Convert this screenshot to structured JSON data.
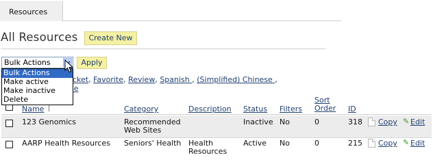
{
  "tabs": {
    "active_label": "Resources"
  },
  "page": {
    "title": "All Resources",
    "create_label": "Create New"
  },
  "bulk": {
    "selected": "Bulk Actions",
    "apply_label": "Apply",
    "options": [
      "Bulk Actions",
      "Make active",
      "Make inactive",
      "Delete"
    ]
  },
  "filters": {
    "line1": [
      {
        "label": "cket"
      },
      {
        "label": "Favorite"
      },
      {
        "label": "Review"
      },
      {
        "label": "Spanish "
      },
      {
        "label": "(Simplified) Chinese "
      }
    ],
    "line2": "se"
  },
  "table": {
    "headers": {
      "name": "Name",
      "category": "Category",
      "description": "Description",
      "status": "Status",
      "filters": "Filters",
      "sort_line1": "Sort",
      "sort_line2": "Order",
      "id": "ID"
    },
    "rows": [
      {
        "name": "123 Genomics",
        "category_line1": "Recommended",
        "category_line2": "Web Sites",
        "description_line1": "",
        "description_line2": "",
        "status": "Inactive",
        "filters": "No",
        "sort": "0",
        "id": "318",
        "copy": "Copy",
        "edit": "Edit"
      },
      {
        "name": "AARP Health Resources",
        "category_line1": "Seniors' Health",
        "category_line2": "",
        "description_line1": "Health",
        "description_line2": "Resources",
        "status": "Active",
        "filters": "No",
        "sort": "0",
        "id": "215",
        "copy": "Copy",
        "edit": "Edit"
      }
    ]
  }
}
